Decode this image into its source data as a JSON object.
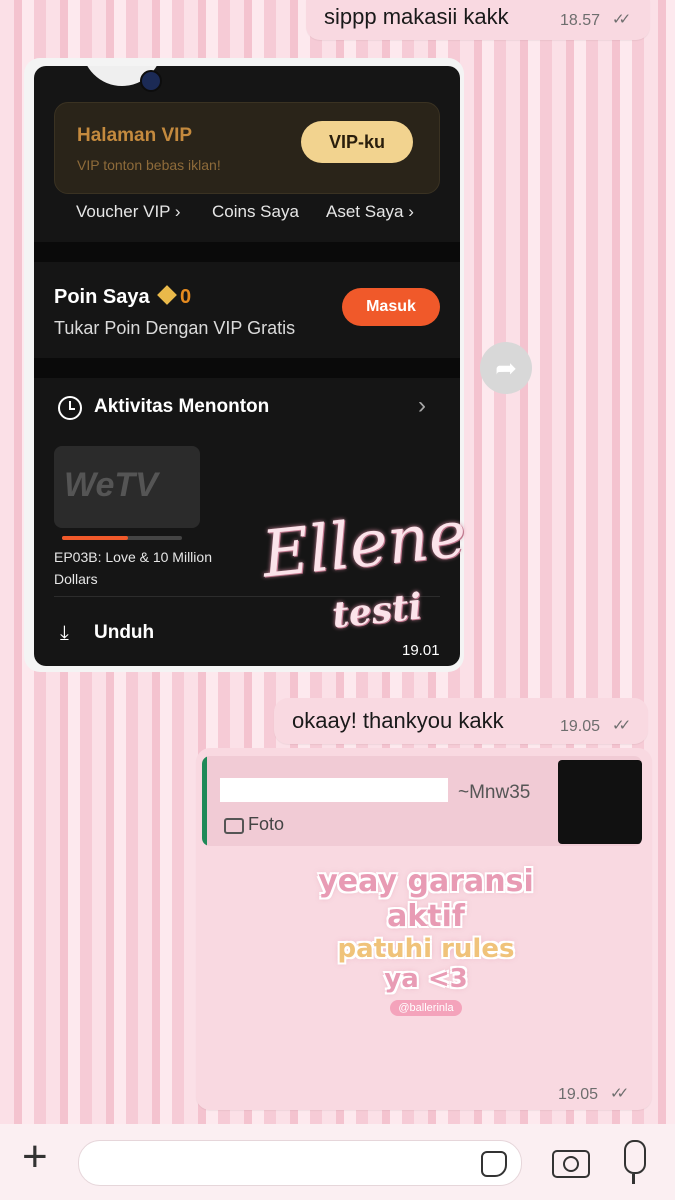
{
  "messages": [
    {
      "text": "sippp makasii kakk",
      "time": "18.57",
      "status": "read-double-tick"
    },
    {
      "text": "okaay! thankyou kakk",
      "time": "19.05",
      "status": "read-double-tick"
    }
  ],
  "screenshot_message": {
    "time": "19.01",
    "vip": {
      "title": "Halaman VIP",
      "subtitle": "VIP tonton bebas iklan!",
      "button": "VIP-ku"
    },
    "links": [
      "Voucher VIP",
      "Coins Saya",
      "Aset Saya"
    ],
    "poin": {
      "title": "Poin Saya",
      "value": "0",
      "subtitle": "Tukar Poin Dengan VIP Gratis",
      "button": "Masuk"
    },
    "activity": {
      "title": "Aktivitas Menonton",
      "thumb_logo": "WeTV",
      "episode": "EP03B: Love & 10 Million Dollars",
      "progress": 0.55
    },
    "download": {
      "title": "Unduh"
    }
  },
  "reply_message": {
    "quoted_name": "~Mnw35",
    "quoted_type": "Foto",
    "sticker_lines": [
      "yeay garansi",
      "aktif",
      "patuhi rules",
      "ya <3"
    ],
    "sticker_handle": "@ballerinla",
    "time": "19.05"
  },
  "watermark": {
    "title": "Ellene",
    "subtitle": "testi"
  },
  "input_bar": {
    "placeholder": ""
  },
  "colors": {
    "bubble": "#f9d9e1",
    "accent_orange": "#f0592a",
    "vip_gold": "#f2d38f"
  }
}
